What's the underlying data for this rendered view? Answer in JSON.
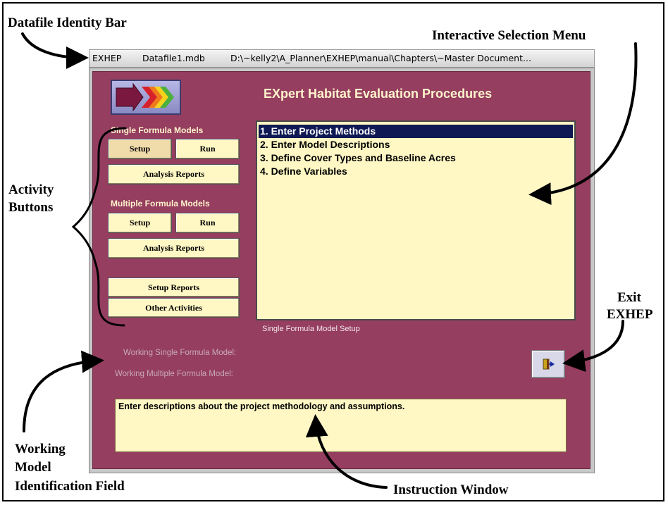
{
  "callouts": {
    "identity_bar": "Datafile Identity Bar",
    "selection_menu": "Interactive Selection Menu",
    "activity_1": "Activity",
    "activity_2": "Buttons",
    "exit_1": "Exit",
    "exit_2": "EXHEP",
    "working_1": "Working",
    "working_2": "Model",
    "working_3": "Identification Field",
    "instruction": "Instruction Window"
  },
  "window": {
    "app_name": "EXHEP",
    "datafile": "Datafile1.mdb",
    "path": "D:\\~kelly2\\A_Planner\\EXHEP\\manual\\Chapters\\~Master Document..."
  },
  "app": {
    "title": "EXpert Habitat Evaluation Procedures",
    "logo_icon": "colored-arrows-logo"
  },
  "single": {
    "label": "Single Formula Models",
    "setup": "Setup",
    "run": "Run",
    "reports": "Analysis Reports"
  },
  "multiple": {
    "label": "Multiple Formula Models",
    "setup": "Setup",
    "run": "Run",
    "reports": "Analysis Reports"
  },
  "other": {
    "setup_reports": "Setup Reports",
    "other_activities": "Other Activities"
  },
  "menu": {
    "items": [
      {
        "label": "1. Enter Project Methods",
        "selected": true
      },
      {
        "label": "2. Enter Model Descriptions",
        "selected": false
      },
      {
        "label": "3. Define Cover Types and Baseline Acres",
        "selected": false
      },
      {
        "label": "4. Define Variables",
        "selected": false
      }
    ]
  },
  "status": "Single Formula Model Setup",
  "working": {
    "single": "Working Single Formula Model:",
    "multiple": "Working Multiple Formula Model:"
  },
  "exit_icon": "exit-door-icon",
  "instruction": "Enter descriptions about the project methodology and assumptions.",
  "colors": {
    "panel": "#953e5f",
    "button": "#fff7c4",
    "menu_selected": "#0f1a54",
    "title_text": "#fff3cc"
  }
}
